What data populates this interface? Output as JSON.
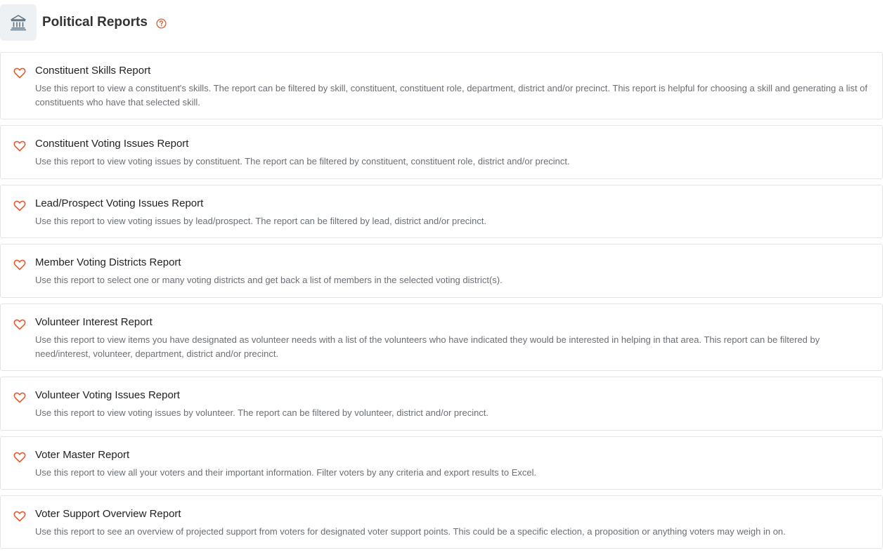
{
  "header": {
    "title": "Political Reports",
    "icon": "bank-building-icon",
    "help_icon": "question-circle-icon"
  },
  "colors": {
    "accent": "#e85a2b",
    "icon_box_bg": "#eef1f3",
    "card_border": "#e2e5e8"
  },
  "reports": [
    {
      "title": "Constituent Skills Report",
      "description": "Use this report to view a constituent's skills. The report can be filtered by skill, constituent, constituent role, department, district and/or precinct. This report is helpful for choosing a skill and generating a list of constituents who have that selected skill."
    },
    {
      "title": "Constituent Voting Issues Report",
      "description": "Use this report to view voting issues by constituent. The report can be filtered by constituent, constituent role, district and/or precinct."
    },
    {
      "title": "Lead/Prospect Voting Issues Report",
      "description": "Use this report to view voting issues by lead/prospect. The report can be filtered by lead, district and/or precinct."
    },
    {
      "title": "Member Voting Districts Report",
      "description": "Use this report to select one or many voting districts and get back a list of members in the selected voting district(s)."
    },
    {
      "title": "Volunteer Interest Report",
      "description": "Use this report to view items you have designated as volunteer needs with a list of the volunteers who have indicated they would be interested in helping in that area. This report can be filtered by need/interest, volunteer, department, district and/or precinct."
    },
    {
      "title": "Volunteer Voting Issues Report",
      "description": "Use this report to view voting issues by volunteer. The report can be filtered by volunteer, district and/or precinct."
    },
    {
      "title": "Voter Master Report",
      "description": "Use this report to view all your voters and their important information. Filter voters by any criteria and export results to Excel."
    },
    {
      "title": "Voter Support Overview Report",
      "description": "Use this report to see an overview of projected support from voters for designated voter support points. This could be a specific election, a proposition or anything voters may weigh in on."
    }
  ]
}
